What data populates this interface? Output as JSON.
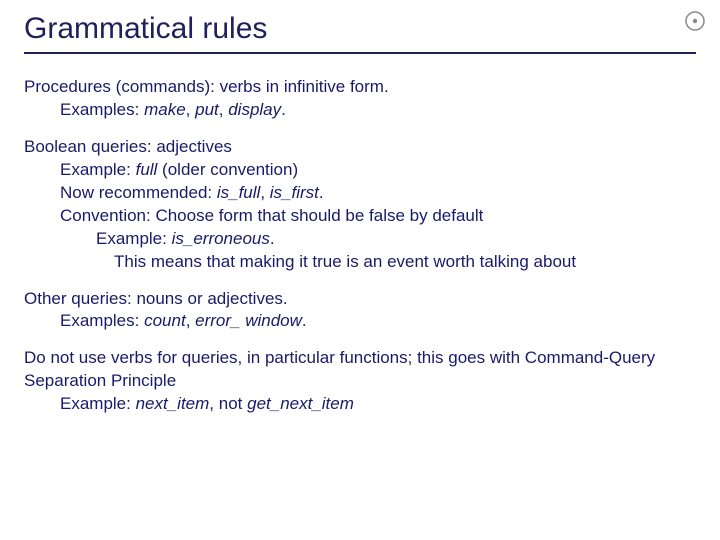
{
  "title": "Grammatical rules",
  "p1": {
    "line1a": "Procedures (commands): verbs in infinitive form.",
    "line2a": "Examples: ",
    "make": "make",
    "sep1": ", ",
    "put": "put",
    "sep2": ", ",
    "display": "display",
    "dot": "."
  },
  "p2": {
    "l1": "Boolean queries: adjectives",
    "l2a": "Example: ",
    "full": "full",
    "l2b": " (older convention)",
    "l3a": "Now recommended: ",
    "isfull": "is_full",
    "sep": ", ",
    "isfirst": "is_first",
    "dot3": ".",
    "l4": "Convention: Choose form that should be false by default",
    "l5a": "Example: ",
    "iserr": "is_erroneous",
    "dot5": ".",
    "l6": "This means that making it true is an event worth talking about"
  },
  "p3": {
    "l1": "Other queries: nouns or adjectives.",
    "l2a": "Examples: ",
    "count": "count",
    "sep": ", ",
    "errwin": "error_ window",
    "dot": "."
  },
  "p4": {
    "l1": "Do not use verbs for queries, in particular functions; this goes with Command-Query Separation Principle",
    "l2a": "Example: ",
    "next": "next_item",
    "sep": ", not ",
    "getnext": "get_next_item"
  }
}
